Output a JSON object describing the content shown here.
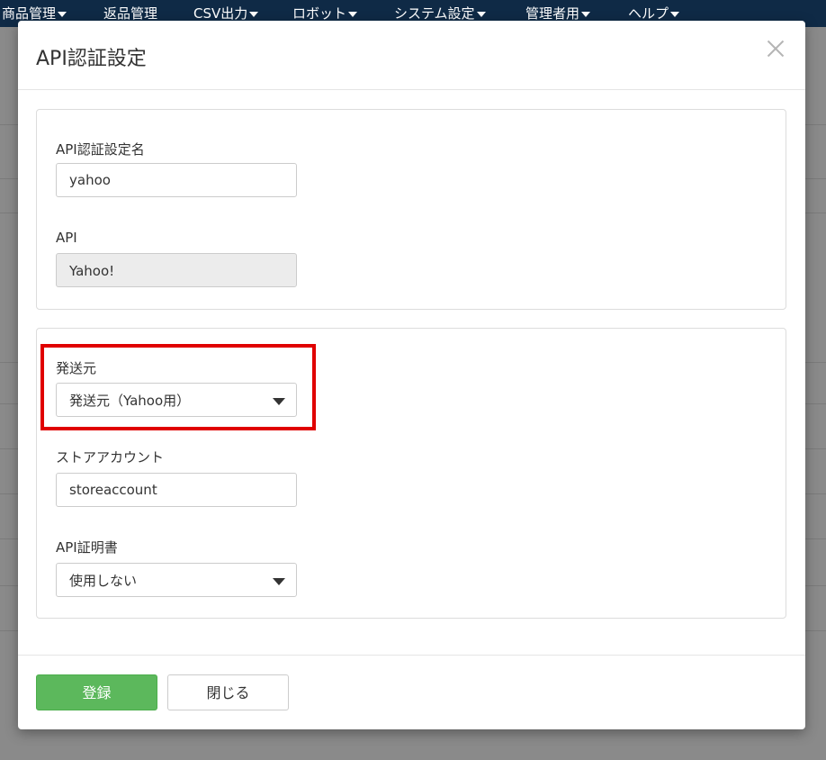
{
  "topnav": {
    "items": [
      {
        "label": "商品管理",
        "has_caret": true
      },
      {
        "label": "返品管理",
        "has_caret": false
      },
      {
        "label": "CSV出力",
        "has_caret": true
      },
      {
        "label": "ロボット",
        "has_caret": true
      },
      {
        "label": "システム設定",
        "has_caret": true
      },
      {
        "label": "管理者用",
        "has_caret": true
      },
      {
        "label": "ヘルプ",
        "has_caret": true
      }
    ]
  },
  "modal": {
    "title": "API認証設定",
    "close_icon": "close-icon",
    "section1": {
      "name_label": "API認証設定名",
      "name_value": "yahoo",
      "api_label": "API",
      "api_value": "Yahoo!"
    },
    "section2": {
      "sender_label": "発送元",
      "sender_value": "発送元（Yahoo用）",
      "store_label": "ストアアカウント",
      "store_value": "storeaccount",
      "cert_label": "API証明書",
      "cert_value": "使用しない"
    },
    "footer": {
      "register_label": "登録",
      "close_label": "閉じる"
    }
  },
  "colors": {
    "nav_bg": "#0f2a46",
    "primary": "#5cb85c",
    "highlight": "#e00000"
  }
}
